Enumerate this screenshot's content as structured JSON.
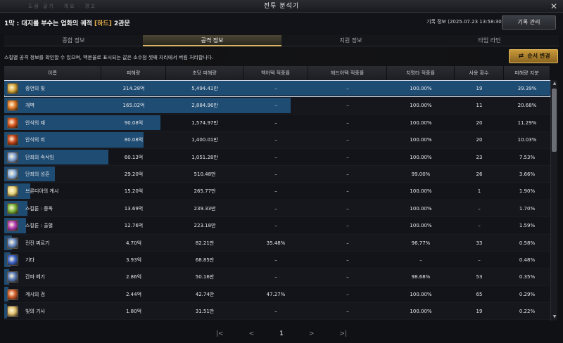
{
  "window": {
    "title": "전투 분석기",
    "ghost_text": "도움 글기  ·  개요  ·  경고"
  },
  "header": {
    "raid_prefix": "1막 : 대지를 부수는 업화의 궤적 ",
    "raid_diff": "[하드]",
    "raid_suffix": " 2관문",
    "record_info": "기록 정보 (2025.07.23 13:58:30)",
    "record_button": "기록 관리"
  },
  "tabs": [
    {
      "label": "종합 정보"
    },
    {
      "label": "공격 정보"
    },
    {
      "label": "지원 정보"
    },
    {
      "label": "타임 라인"
    }
  ],
  "notice": "스킬별 공격 정보를 확인할 수 있으며, 백분율로 표시되는 값은 소수점 셋째 자리에서 버림 처리합니다.",
  "order_button": "순서 변경",
  "columns": [
    "이름",
    "피해량",
    "초당 피해량",
    "백어택 적중률",
    "헤드어택 적중률",
    "치명타 적중률",
    "사용 횟수",
    "피해량 지분"
  ],
  "rows": [
    {
      "name": "종언의 빛",
      "damage": "314.28억",
      "dps": "5,494.41만",
      "back": "–",
      "head": "–",
      "crit": "100.00%",
      "uses": "19",
      "share": "39.39%",
      "share_val": 39.39,
      "icon_color": "#d4a63c"
    },
    {
      "name": "개벽",
      "damage": "165.02억",
      "dps": "2,884.96만",
      "back": "–",
      "head": "–",
      "crit": "100.00%",
      "uses": "11",
      "share": "20.68%",
      "share_val": 20.68,
      "icon_color": "#e07a28"
    },
    {
      "name": "안식의 재",
      "damage": "90.08억",
      "dps": "1,574.97만",
      "back": "–",
      "head": "–",
      "crit": "100.00%",
      "uses": "20",
      "share": "11.29%",
      "share_val": 11.29,
      "icon_color": "#d9561f"
    },
    {
      "name": "안식의 비",
      "damage": "80.08억",
      "dps": "1,400.01만",
      "back": "–",
      "head": "–",
      "crit": "100.00%",
      "uses": "20",
      "share": "10.03%",
      "share_val": 10.03,
      "icon_color": "#c8461c"
    },
    {
      "name": "단죄의 속삭임",
      "damage": "60.13억",
      "dps": "1,051.28만",
      "back": "–",
      "head": "–",
      "crit": "100.00%",
      "uses": "23",
      "share": "7.53%",
      "share_val": 7.53,
      "icon_color": "#7fa2d6"
    },
    {
      "name": "단죄의 성흔",
      "damage": "29.20억",
      "dps": "510.48만",
      "back": "–",
      "head": "–",
      "crit": "99.00%",
      "uses": "26",
      "share": "3.66%",
      "share_val": 3.66,
      "icon_color": "#8ab0e0"
    },
    {
      "name": "브론디아의 계시",
      "damage": "15.20억",
      "dps": "265.77만",
      "back": "–",
      "head": "–",
      "crit": "100.00%",
      "uses": "1",
      "share": "1.90%",
      "share_val": 1.9,
      "icon_color": "#e6d27a"
    },
    {
      "name": "스킬룬 : 중독",
      "damage": "13.69억",
      "dps": "239.33만",
      "back": "–",
      "head": "–",
      "crit": "100.00%",
      "uses": "–",
      "share": "1.70%",
      "share_val": 1.7,
      "icon_color": "#7ab53a"
    },
    {
      "name": "스킬룬 : 출혈",
      "damage": "12.76억",
      "dps": "223.18만",
      "back": "–",
      "head": "–",
      "crit": "100.00%",
      "uses": "–",
      "share": "1.59%",
      "share_val": 1.59,
      "icon_color": "#b43ab5"
    },
    {
      "name": "전진 찌르기",
      "damage": "4.70억",
      "dps": "82.21만",
      "back": "35.48%",
      "head": "–",
      "crit": "96.77%",
      "uses": "33",
      "share": "0.58%",
      "share_val": 0.58,
      "icon_color": "#6a8cc8"
    },
    {
      "name": "기타",
      "damage": "3.93억",
      "dps": "68.85만",
      "back": "–",
      "head": "–",
      "crit": "–",
      "uses": "–",
      "share": "0.48%",
      "share_val": 0.48,
      "icon_color": "#3a62c8"
    },
    {
      "name": "간파 베기",
      "damage": "2.86억",
      "dps": "50.16만",
      "back": "–",
      "head": "–",
      "crit": "98.68%",
      "uses": "53",
      "share": "0.35%",
      "share_val": 0.35,
      "icon_color": "#5a7bb8"
    },
    {
      "name": "계시의 검",
      "damage": "2.44억",
      "dps": "42.74만",
      "back": "47.27%",
      "head": "–",
      "crit": "100.00%",
      "uses": "65",
      "share": "0.29%",
      "share_val": 0.29,
      "icon_color": "#d05a2a"
    },
    {
      "name": "빛의 기사",
      "damage": "1.80억",
      "dps": "31.51만",
      "back": "–",
      "head": "–",
      "crit": "100.00%",
      "uses": "19",
      "share": "0.22%",
      "share_val": 0.22,
      "icon_color": "#e0c070"
    }
  ],
  "pager": {
    "first": "|<",
    "prev": "<",
    "current": "1",
    "next": ">",
    "last": ">|"
  },
  "colors": {
    "bar": "#1f4c73",
    "accent": "#d9b466"
  }
}
